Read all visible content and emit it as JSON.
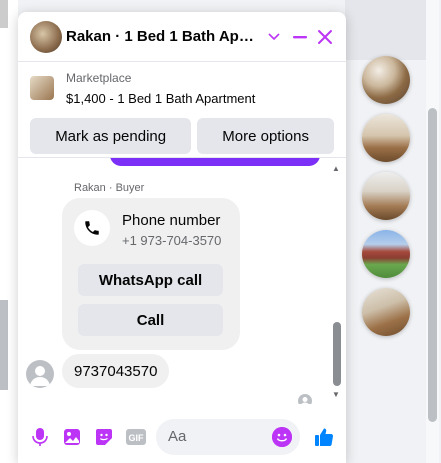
{
  "chat": {
    "title": "Rakan · 1 Bed 1 Bath Apart…",
    "icons": {
      "chevron": "chevron-down-icon",
      "minimize": "minimize-icon",
      "close": "close-icon"
    }
  },
  "listing": {
    "source": "Marketplace",
    "title": "$1,400 - 1 Bed 1 Bath Apartment",
    "mark_pending_label": "Mark as pending",
    "more_options_label": "More options"
  },
  "messages": {
    "sender_label": "Rakan · Buyer",
    "phone_card": {
      "title": "Phone number",
      "number": "+1 973-704-3570",
      "whatsapp_label": "WhatsApp call",
      "call_label": "Call"
    },
    "last_message": "9737043570"
  },
  "composer": {
    "placeholder": "Aa",
    "icons": [
      "mic-icon",
      "photo-icon",
      "sticker-icon",
      "gif-icon",
      "emoji-icon",
      "like-icon"
    ],
    "gif_label": "GIF"
  },
  "colors": {
    "accent": "#bc34f5",
    "like": "#0084ff",
    "sent_bubble": "#7b2ff7"
  }
}
